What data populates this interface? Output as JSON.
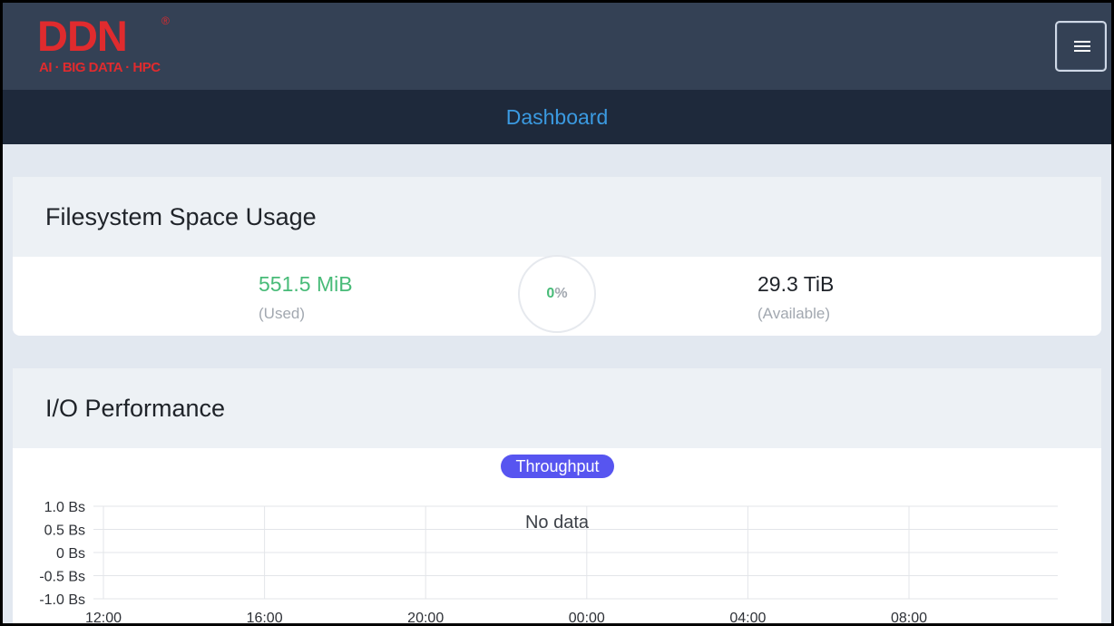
{
  "brand": {
    "logo_text": "DDN",
    "tagline": "AI · BIG DATA · HPC",
    "registered_mark": "®",
    "color": "#e02b2e"
  },
  "header": {
    "menu_icon": "hamburger-menu-icon"
  },
  "nav": {
    "title": "Dashboard",
    "color": "#3b9ae1"
  },
  "filesystem": {
    "title": "Filesystem Space Usage",
    "used_value": "551.5 MiB",
    "used_label": "(Used)",
    "used_color": "#48bb78",
    "usage_percent_number": "0",
    "usage_percent_sign": "%",
    "available_value": "29.3 TiB",
    "available_label": "(Available)"
  },
  "io": {
    "title": "I/O Performance",
    "active_tab": "Throughput",
    "tab_color": "#5755f0"
  },
  "chart_data": {
    "type": "line",
    "title": "",
    "xlabel": "",
    "ylabel": "",
    "y_ticks": [
      "1.0 Bs",
      "0.5 Bs",
      "0 Bs",
      "-0.5 Bs",
      "-1.0 Bs"
    ],
    "x_ticks": [
      "12:00",
      "16:00",
      "20:00",
      "00:00",
      "04:00",
      "08:00"
    ],
    "ylim": [
      -1.0,
      1.0
    ],
    "series": [],
    "grid": true,
    "annotation": "No data"
  }
}
